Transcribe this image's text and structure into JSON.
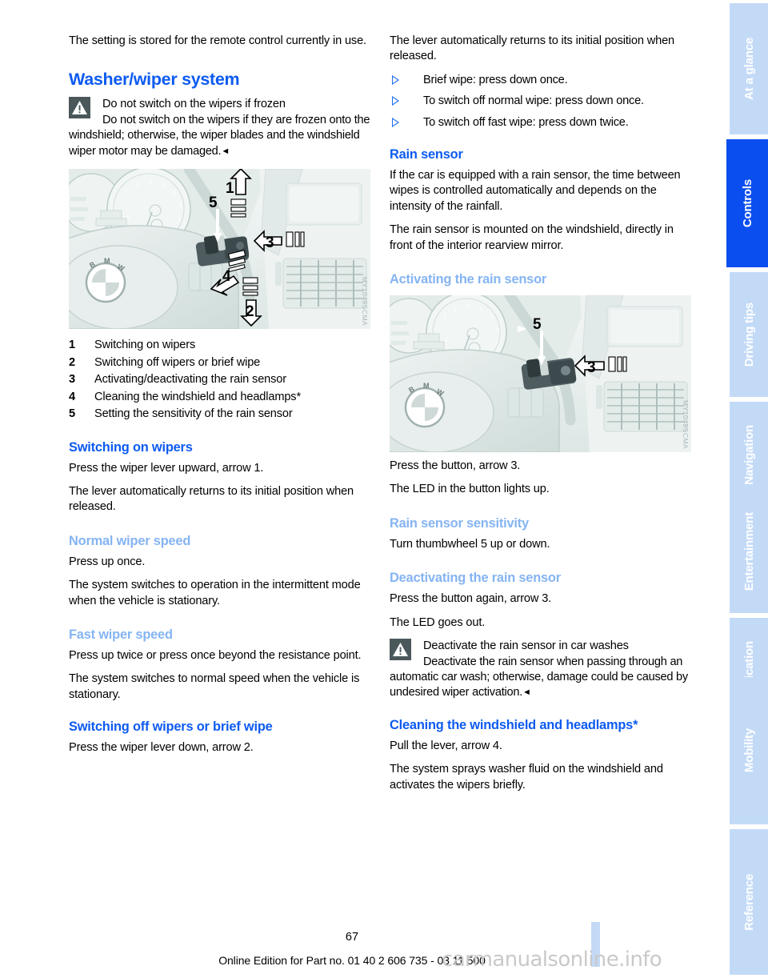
{
  "document": {
    "page_number": "67",
    "footer_note": "Online Edition for Part no. 01 40 2 606 735 - 03 11 500",
    "footer_watermark": "carmanualsonline.info",
    "colors": {
      "heading_blue": "#0d5bf0",
      "subheading_blue": "#85b4f2",
      "tab_inactive": "#c3daf7",
      "tab_active": "#0b4ef0",
      "warning_icon": "#4a585c"
    }
  },
  "left_column": {
    "intro": "The setting is stored for the remote control currently in use.",
    "section_title": "Washer/wiper system",
    "warning": {
      "title": "Do not switch on the wipers if frozen",
      "body": "Do not switch on the wipers if they are frozen onto the windshield; otherwise, the wiper blades and the windshield wiper motor may be damaged.",
      "endmark": "◄"
    },
    "figure": {
      "caption_code": "MY1049SCMA",
      "alt": "BMW steering wheel and instrument cluster with wiper stalk, callouts 1 to 5"
    },
    "legend": [
      {
        "num": "1",
        "label": "Switching on wipers"
      },
      {
        "num": "2",
        "label": "Switching off wipers or brief wipe"
      },
      {
        "num": "3",
        "label": "Activating/deactivating the rain sensor"
      },
      {
        "num": "4",
        "label": "Cleaning the windshield and headlamps*"
      },
      {
        "num": "5",
        "label": "Setting the sensitivity of the rain sensor"
      }
    ],
    "switching_on": {
      "heading": "Switching on wipers",
      "p1": "Press the wiper lever upward, arrow 1.",
      "p2": "The lever automatically returns to its initial position when released."
    },
    "normal_speed": {
      "heading": "Normal wiper speed",
      "p1": "Press up once.",
      "p2": "The system switches to operation in the intermittent mode when the vehicle is stationary."
    },
    "fast_speed": {
      "heading": "Fast wiper speed",
      "p1": "Press up twice or press once beyond the resistance point.",
      "p2": "The system switches to normal speed when the vehicle is stationary."
    },
    "switching_off": {
      "heading": "Switching off wipers or brief wipe",
      "p1": "Press the wiper lever down, arrow 2."
    }
  },
  "right_column": {
    "intro": "The lever automatically returns to its initial position when released.",
    "bullets": [
      "Brief wipe: press down once.",
      "To switch off normal wipe: press down once.",
      "To switch off fast wipe: press down twice."
    ],
    "rain_sensor": {
      "heading": "Rain sensor",
      "p1": "If the car is equipped with a rain sensor, the time between wipes is controlled automatically and depends on the intensity of the rainfall.",
      "p2": "The rain sensor is mounted on the windshield, directly in front of the interior rearview mirror."
    },
    "activating": {
      "heading": "Activating the rain sensor",
      "figure": {
        "caption_code": "MY1049SCMA",
        "alt": "BMW steering wheel with wiper stalk, callouts 5 and 3"
      },
      "p1": "Press the button, arrow 3.",
      "p2": "The LED in the button lights up."
    },
    "sensitivity": {
      "heading": "Rain sensor sensitivity",
      "p1": "Turn thumbwheel 5 up or down."
    },
    "deactivating": {
      "heading": "Deactivating the rain sensor",
      "p1": "Press the button again, arrow 3.",
      "p2": "The LED goes out.",
      "warning": {
        "title": "Deactivate the rain sensor in car washes",
        "body": "Deactivate the rain sensor when passing through an automatic car wash; otherwise, damage could be caused by undesired wiper activation.",
        "endmark": "◄"
      }
    },
    "cleaning": {
      "heading": "Cleaning the windshield and headlamps*",
      "p1": "Pull the lever, arrow 4.",
      "p2": "The system sprays washer fluid on the windshield and activates the wipers briefly."
    }
  },
  "sidebar": {
    "tabs": [
      {
        "label": "At a glance",
        "active": false
      },
      {
        "label": "Controls",
        "active": true
      },
      {
        "label": "Driving tips",
        "active": false
      },
      {
        "label": "Navigation",
        "active": false
      },
      {
        "label": "Entertainment",
        "active": false
      },
      {
        "label": "Communication",
        "active": false
      },
      {
        "label": "Mobility",
        "active": false
      },
      {
        "label": "Reference",
        "active": false
      }
    ]
  }
}
